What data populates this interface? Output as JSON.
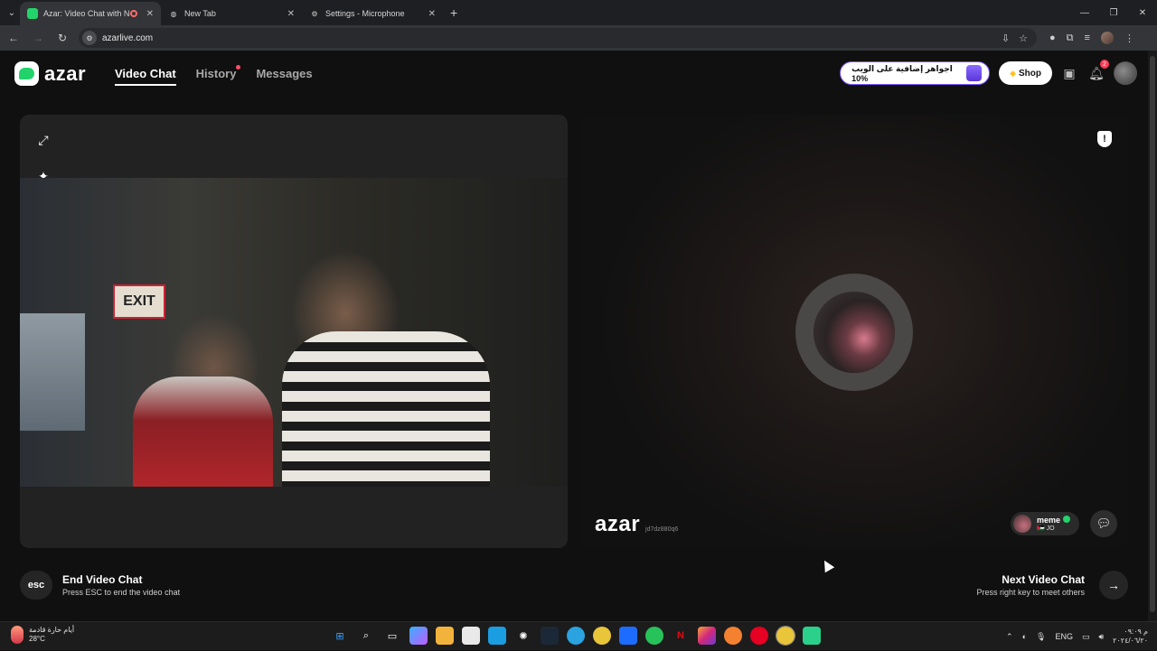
{
  "browser": {
    "tabs": [
      {
        "title": "Azar: Video Chat with New",
        "favicon": "azar-icon",
        "active": true,
        "recording": true
      },
      {
        "title": "New Tab",
        "favicon": "globe-icon",
        "active": false
      },
      {
        "title": "Settings - Microphone",
        "favicon": "gear-icon",
        "active": false
      }
    ],
    "url": "azarlive.com"
  },
  "app": {
    "logo_text": "azar",
    "nav": {
      "video_chat": "Video Chat",
      "history": "History",
      "messages": "Messages"
    },
    "promo_text": "اجواهر إضافية على الويب 10%",
    "shop_label": "Shop",
    "notification_count": "2",
    "left_panel": {
      "exit_sign": "EXIT"
    },
    "right_panel": {
      "watermark": "azar",
      "watermark_id": "jd7dz880q6",
      "peer_name": "meme",
      "peer_country": "🇯🇴 JO"
    },
    "footer": {
      "esc_key": "esc",
      "end_title": "End Video Chat",
      "end_sub": "Press ESC to end the video chat",
      "next_title": "Next Video Chat",
      "next_sub": "Press right key to meet others"
    }
  },
  "taskbar": {
    "weather_text": "أيام حارة قادمة",
    "temperature": "28°C",
    "language": "ENG",
    "time": "م ٠٩:٠٩",
    "date": "٢٠٢٤/٠٦/٢٠"
  },
  "colors": {
    "accent_green": "#22d36b",
    "promo_border": "#7d56ff",
    "badge_red": "#ff3b57"
  }
}
